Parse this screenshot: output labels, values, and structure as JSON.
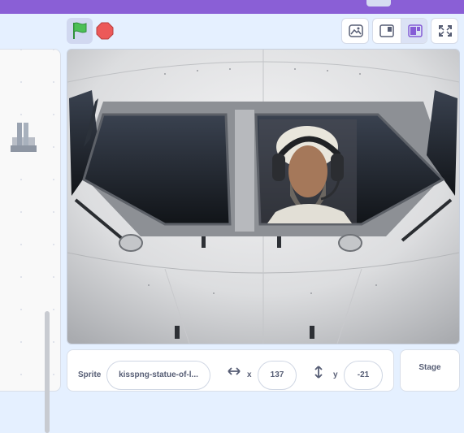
{
  "stage_header": {
    "green_flag": "green-flag-icon",
    "stop": "stop-icon",
    "editor_mode": "paint-editor-icon",
    "small_stage": "small-stage-icon",
    "normal_stage": "normal-stage-icon",
    "fullscreen": "fullscreen-icon"
  },
  "sprite_info": {
    "sprite_label": "Sprite",
    "sprite_name": "kisspng-statue-of-l...",
    "x_label": "x",
    "x_value": "137",
    "y_label": "y",
    "y_value": "-21"
  },
  "stage_panel": {
    "label": "Stage"
  },
  "colors": {
    "menu_bar": "#8a5fd6",
    "background": "#e5f0ff",
    "active_toggle": "#dbe2f5",
    "flag": "#4cbf56",
    "stop": "#ec5959"
  }
}
